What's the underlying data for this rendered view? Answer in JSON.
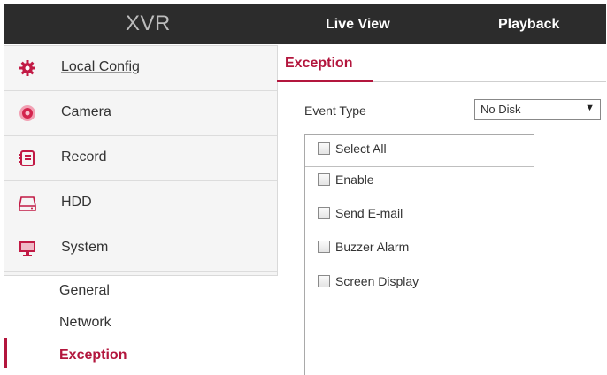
{
  "header": {
    "logo": "XVR",
    "nav": [
      {
        "label": "Live View"
      },
      {
        "label": "Playback"
      }
    ]
  },
  "sidebar": {
    "items": [
      {
        "label": "Local Config",
        "icon": "gear-icon"
      },
      {
        "label": "Camera",
        "icon": "camera-icon"
      },
      {
        "label": "Record",
        "icon": "record-icon"
      },
      {
        "label": "HDD",
        "icon": "hdd-icon"
      },
      {
        "label": "System",
        "icon": "monitor-icon"
      }
    ],
    "subitems": [
      {
        "label": "General"
      },
      {
        "label": "Network"
      },
      {
        "label": "Exception",
        "active": true
      }
    ]
  },
  "main": {
    "tab": "Exception",
    "event_type": {
      "label": "Event Type",
      "value": "No Disk"
    },
    "checkboxes": {
      "select_all": "Select All",
      "items": [
        {
          "label": "Enable"
        },
        {
          "label": "Send E-mail"
        },
        {
          "label": "Buzzer Alarm"
        },
        {
          "label": "Screen Display"
        }
      ]
    }
  },
  "colors": {
    "accent": "#b3163d",
    "topbar": "#2c2c2c"
  }
}
